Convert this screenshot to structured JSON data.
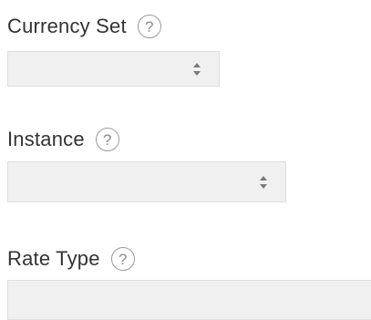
{
  "fields": [
    {
      "label": "Currency Set",
      "help_glyph": "?",
      "value": "",
      "control": "select"
    },
    {
      "label": "Instance",
      "help_glyph": "?",
      "value": "",
      "control": "select"
    },
    {
      "label": "Rate Type",
      "help_glyph": "?",
      "value": "",
      "control": "input"
    }
  ],
  "icons": {
    "help": "help-circle-icon",
    "select": "select-arrows-icon"
  },
  "colors": {
    "label": "#333333",
    "field_background": "#f0f0f0",
    "field_border": "#dedede",
    "help_icon": "#9a9a9a"
  }
}
